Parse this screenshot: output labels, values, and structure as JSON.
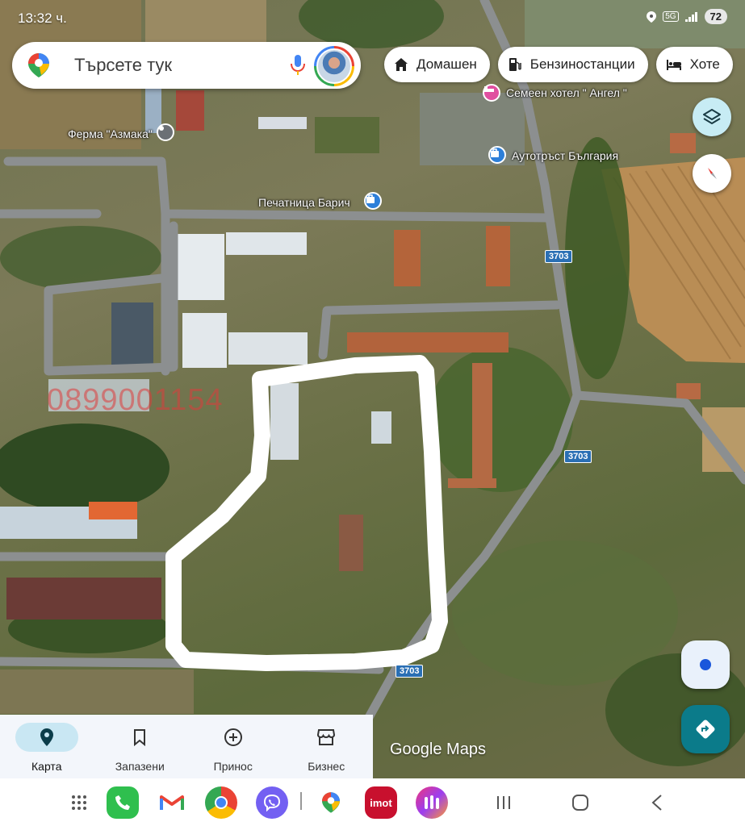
{
  "status_bar": {
    "time": "13:32 ч.",
    "network": "5G",
    "battery": "72"
  },
  "search": {
    "placeholder": "Търсете тук"
  },
  "chips": [
    {
      "label": "Домашен",
      "icon": "home-icon"
    },
    {
      "label": "Бензиностанции",
      "icon": "gas-station-icon"
    },
    {
      "label": "Хоте",
      "icon": "hotel-icon"
    }
  ],
  "map": {
    "labels": {
      "ferma": "Ферма \"Азмака\"",
      "hotel": "Семеен хотел \" Ангел \"",
      "avtotrast": "Аутотръст България",
      "pechatnica": "Печатница Барич"
    },
    "road_numbers": [
      "3703",
      "3703",
      "3703"
    ],
    "watermark": "0899001154",
    "attribution": "Google Maps"
  },
  "bottom_nav": [
    {
      "label": "Карта",
      "icon": "map-pin-icon",
      "active": true
    },
    {
      "label": "Запазени",
      "icon": "bookmark-icon",
      "active": false
    },
    {
      "label": "Принос",
      "icon": "add-circle-icon",
      "active": false
    },
    {
      "label": "Бизнес",
      "icon": "store-icon",
      "active": false
    }
  ],
  "dock_apps": [
    "apps-grid-icon",
    "phone-icon",
    "gmail-icon",
    "chrome-icon",
    "viber-icon",
    "maps-icon",
    "imot-icon",
    "app-icon"
  ],
  "imot_label": "imot",
  "colors": {
    "accent": "#0b7b8a",
    "layer_button": "#c7ecf4",
    "nav_active": "#c9e7f3"
  }
}
